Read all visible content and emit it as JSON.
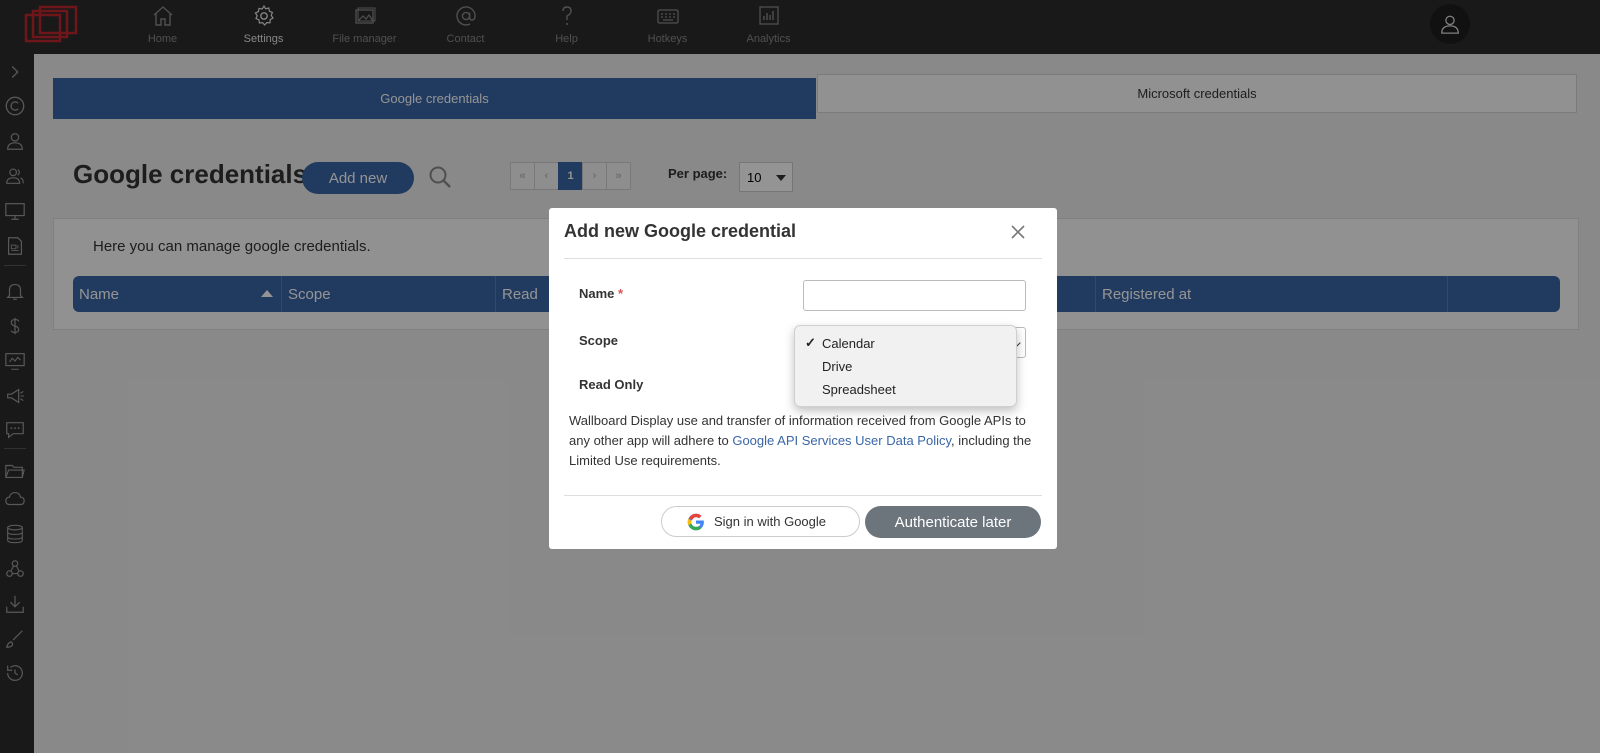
{
  "nav": {
    "items": [
      {
        "label": "Home",
        "icon": "home-icon",
        "active": false
      },
      {
        "label": "Settings",
        "icon": "gear-icon",
        "active": true
      },
      {
        "label": "File manager",
        "icon": "image-icon",
        "active": false
      },
      {
        "label": "Contact",
        "icon": "at-icon",
        "active": false
      },
      {
        "label": "Help",
        "icon": "question-icon",
        "active": false
      },
      {
        "label": "Hotkeys",
        "icon": "keyboard-icon",
        "active": false
      },
      {
        "label": "Analytics",
        "icon": "chart-icon",
        "active": false
      }
    ]
  },
  "sidebar": {
    "icons": [
      "chevron-right-icon",
      "copyright-icon",
      "user-icon",
      "users-icon",
      "monitor-icon",
      "document-icon",
      "bell-icon",
      "dollar-icon",
      "screen-icon",
      "megaphone-icon",
      "chat-icon",
      "folder-icon",
      "cloud-icon",
      "database-icon",
      "webhook-icon",
      "download-icon",
      "brush-icon",
      "history-icon"
    ]
  },
  "tabs": {
    "google": "Google credentials",
    "microsoft": "Microsoft credentials"
  },
  "page": {
    "title": "Google credentials",
    "add_new": "Add new",
    "description": "Here you can manage google credentials."
  },
  "pagination": {
    "first": "«",
    "prev": "‹",
    "current": "1",
    "next": "›",
    "last": "»",
    "per_page_label": "Per page:",
    "per_page_value": "10"
  },
  "table": {
    "columns": [
      "Name",
      "Scope",
      "Read",
      "",
      "",
      "Registered at",
      ""
    ]
  },
  "modal": {
    "title": "Add new Google credential",
    "name_label": "Name",
    "required_mark": "*",
    "scope_label": "Scope",
    "read_only_label": "Read Only",
    "scope_options": [
      "Calendar",
      "Drive",
      "Spreadsheet"
    ],
    "scope_selected": "Calendar",
    "check_mark": "✓",
    "policy_before": "Wallboard Display use and transfer of information received from Google APIs to any other app will adhere to ",
    "policy_link": "Google API Services User Data Policy",
    "policy_after": ", including the Limited Use requirements.",
    "sign_in": "Sign in with Google",
    "authenticate_later": "Authenticate later"
  },
  "colors": {
    "accent": "#3a66a6",
    "topbar": "#2b2b2b",
    "auth_button": "#6c747c",
    "logo_red": "#c0272d"
  }
}
